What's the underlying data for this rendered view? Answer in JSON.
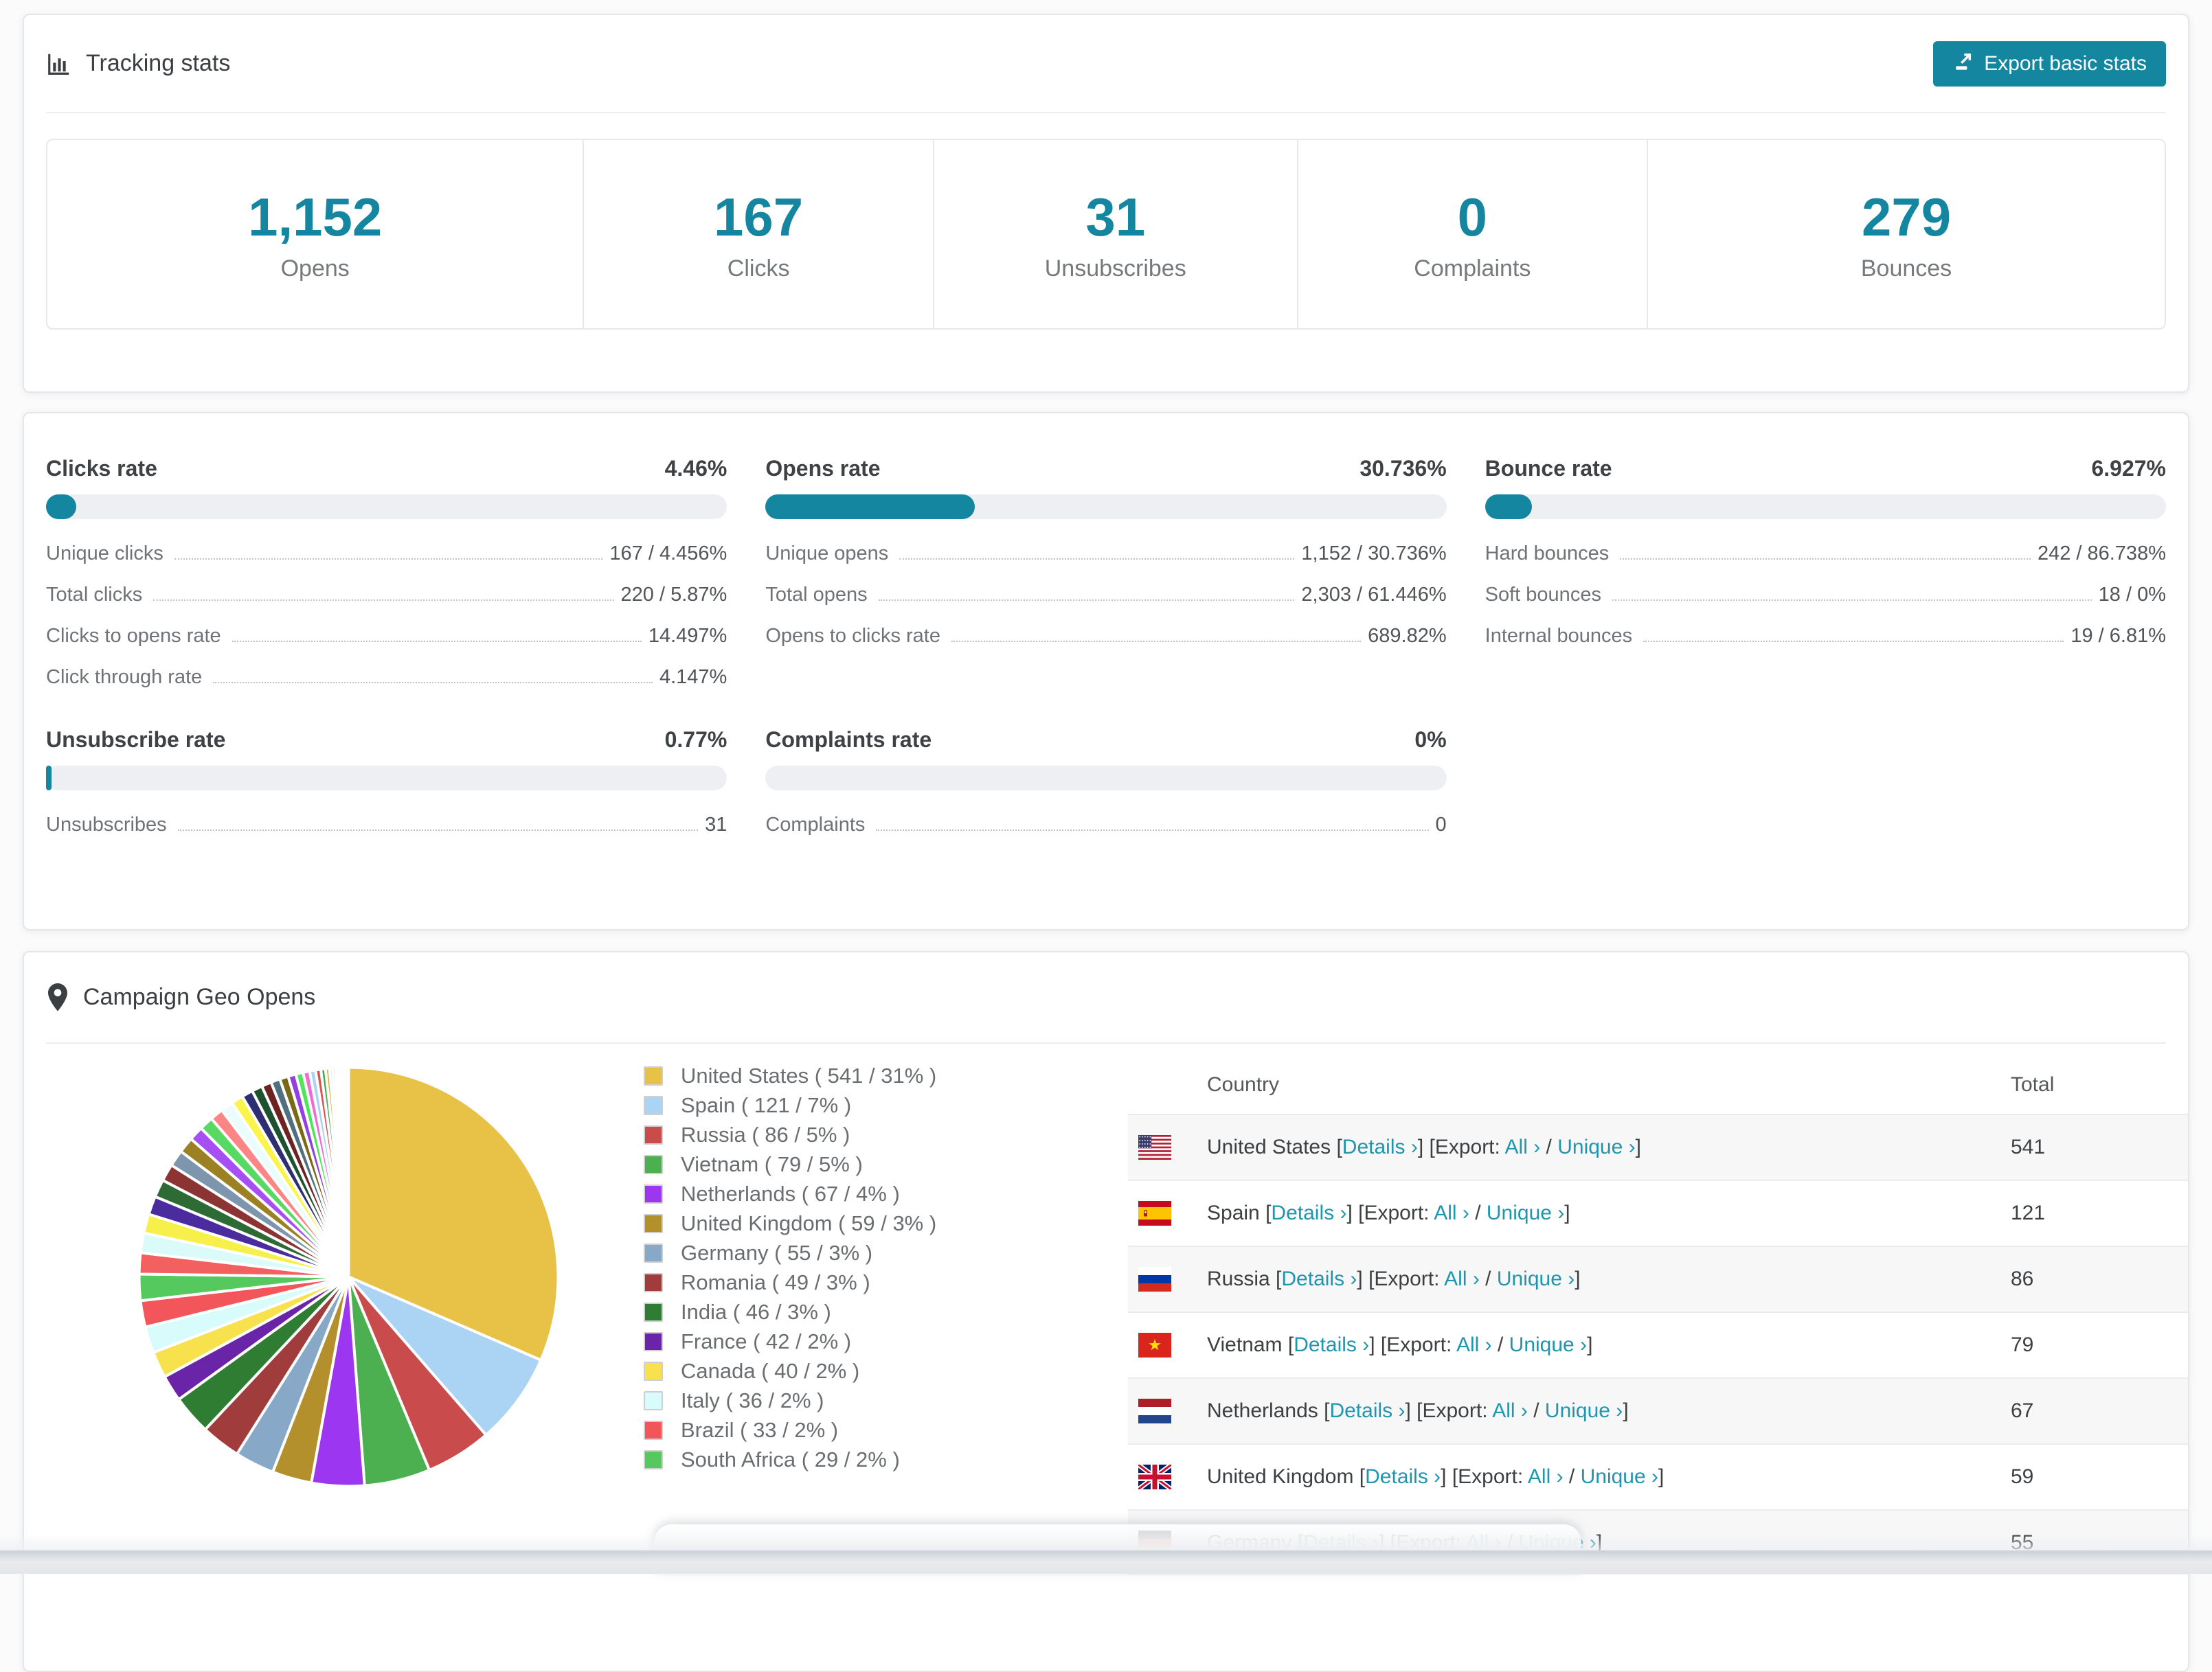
{
  "app": {
    "accent_color": "#15869f",
    "link_color": "#1f96ae"
  },
  "tracking": {
    "title": "Tracking stats",
    "export_button": {
      "label": "Export basic stats",
      "icon": "export-icon"
    },
    "stats": [
      {
        "value": "1,152",
        "label": "Opens"
      },
      {
        "value": "167",
        "label": "Clicks"
      },
      {
        "value": "31",
        "label": "Unsubscribes"
      },
      {
        "value": "0",
        "label": "Complaints"
      },
      {
        "value": "279",
        "label": "Bounces"
      }
    ]
  },
  "rates": {
    "blocks": [
      {
        "title": "Clicks rate",
        "value": "4.46%",
        "percent": 4.46,
        "rows": [
          {
            "label": "Unique clicks",
            "value": "167 / 4.456%"
          },
          {
            "label": "Total clicks",
            "value": "220 / 5.87%"
          },
          {
            "label": "Clicks to opens rate",
            "value": "14.497%"
          },
          {
            "label": "Click through rate",
            "value": "4.147%"
          }
        ]
      },
      {
        "title": "Opens rate",
        "value": "30.736%",
        "percent": 30.736,
        "rows": [
          {
            "label": "Unique opens",
            "value": "1,152 / 30.736%"
          },
          {
            "label": "Total opens",
            "value": "2,303 / 61.446%"
          },
          {
            "label": "Opens to clicks rate",
            "value": "689.82%"
          }
        ]
      },
      {
        "title": "Bounce rate",
        "value": "6.927%",
        "percent": 6.927,
        "rows": [
          {
            "label": "Hard bounces",
            "value": "242 / 86.738%"
          },
          {
            "label": "Soft bounces",
            "value": "18 / 0%"
          },
          {
            "label": "Internal bounces",
            "value": "19 / 6.81%"
          }
        ]
      },
      {
        "title": "Unsubscribe rate",
        "value": "0.77%",
        "percent": 0.77,
        "rows": [
          {
            "label": "Unsubscribes",
            "value": "31"
          }
        ]
      },
      {
        "title": "Complaints rate",
        "value": "0%",
        "percent": 0,
        "rows": [
          {
            "label": "Complaints",
            "value": "0"
          }
        ]
      }
    ]
  },
  "geo": {
    "title": "Campaign Geo Opens",
    "table": {
      "headers": [
        "Country",
        "Total"
      ],
      "links": {
        "details": "Details ›",
        "export_prefix": "Export: ",
        "all": "All ›",
        "unique": "Unique ›"
      },
      "rows": [
        {
          "country": "United States",
          "flag": "us",
          "total": "541"
        },
        {
          "country": "Spain",
          "flag": "es",
          "total": "121"
        },
        {
          "country": "Russia",
          "flag": "ru",
          "total": "86"
        },
        {
          "country": "Vietnam",
          "flag": "vn",
          "total": "79"
        },
        {
          "country": "Netherlands",
          "flag": "nl",
          "total": "67"
        },
        {
          "country": "United Kingdom",
          "flag": "gb",
          "total": "59"
        },
        {
          "country": "Germany",
          "flag": "de",
          "total": "55"
        }
      ]
    }
  },
  "chart_data": {
    "type": "pie",
    "title": "Campaign Geo Opens",
    "legend_position": "right",
    "start_angle_deg": 0,
    "direction": "clockwise",
    "series": [
      {
        "label": "United States",
        "value": 541,
        "percent": 31,
        "color": "#e8c247"
      },
      {
        "label": "Spain",
        "value": 121,
        "percent": 7,
        "color": "#abd4f4"
      },
      {
        "label": "Russia",
        "value": 86,
        "percent": 5,
        "color": "#c94b4b"
      },
      {
        "label": "Vietnam",
        "value": 79,
        "percent": 5,
        "color": "#4caf50"
      },
      {
        "label": "Netherlands",
        "value": 67,
        "percent": 4,
        "color": "#9c36f0"
      },
      {
        "label": "United Kingdom",
        "value": 59,
        "percent": 3,
        "color": "#b3902c"
      },
      {
        "label": "Germany",
        "value": 55,
        "percent": 3,
        "color": "#87a9c7"
      },
      {
        "label": "Romania",
        "value": 49,
        "percent": 3,
        "color": "#a03c3c"
      },
      {
        "label": "India",
        "value": 46,
        "percent": 3,
        "color": "#2e7d32"
      },
      {
        "label": "France",
        "value": 42,
        "percent": 2,
        "color": "#6a24a8"
      },
      {
        "label": "Canada",
        "value": 40,
        "percent": 2,
        "color": "#f7e14d"
      },
      {
        "label": "Italy",
        "value": 36,
        "percent": 2,
        "color": "#d8fbfb"
      },
      {
        "label": "Brazil",
        "value": 33,
        "percent": 2,
        "color": "#f2555a"
      },
      {
        "label": "South Africa",
        "value": 29,
        "percent": 2,
        "color": "#55c85e"
      }
    ],
    "others_unlabeled": {
      "note": "tail of many small unlabeled country slices",
      "values": [
        1.6,
        1.5,
        1.45,
        1.4,
        1.35,
        1.3,
        1.25,
        1.2,
        1.1,
        1.05,
        1.0,
        0.95,
        0.9,
        0.85,
        0.8,
        0.75,
        0.7,
        0.65,
        0.6,
        0.55,
        0.5,
        0.45,
        0.4,
        0.35,
        0.3,
        0.25,
        0.22,
        0.2,
        0.17,
        0.15,
        0.12,
        0.1,
        0.08,
        0.06,
        0.05,
        0.04
      ],
      "colors": [
        "#f26060",
        "#dbfbfb",
        "#f7ef4a",
        "#4b2c9e",
        "#2e6b34",
        "#8c3434",
        "#7d95ad",
        "#9c8124",
        "#a64ff2",
        "#57d964",
        "#fd8585",
        "#eafcfc",
        "#fbf44c",
        "#2e2e73",
        "#1d5230",
        "#6e2222",
        "#50707f",
        "#7a6a16",
        "#9340e0",
        "#4ce65a",
        "#f06bd4",
        "#a8d3f2",
        "#e05050",
        "#3fae4c",
        "#d9a92e",
        "#caf0f8",
        "#e8425a",
        "#7a3bd4",
        "#57b6d9",
        "#b5e853",
        "#f2a2c4",
        "#8898a8",
        "#c4b03a",
        "#66d9c2",
        "#d45a9e",
        "#9cb8d9"
      ]
    }
  }
}
